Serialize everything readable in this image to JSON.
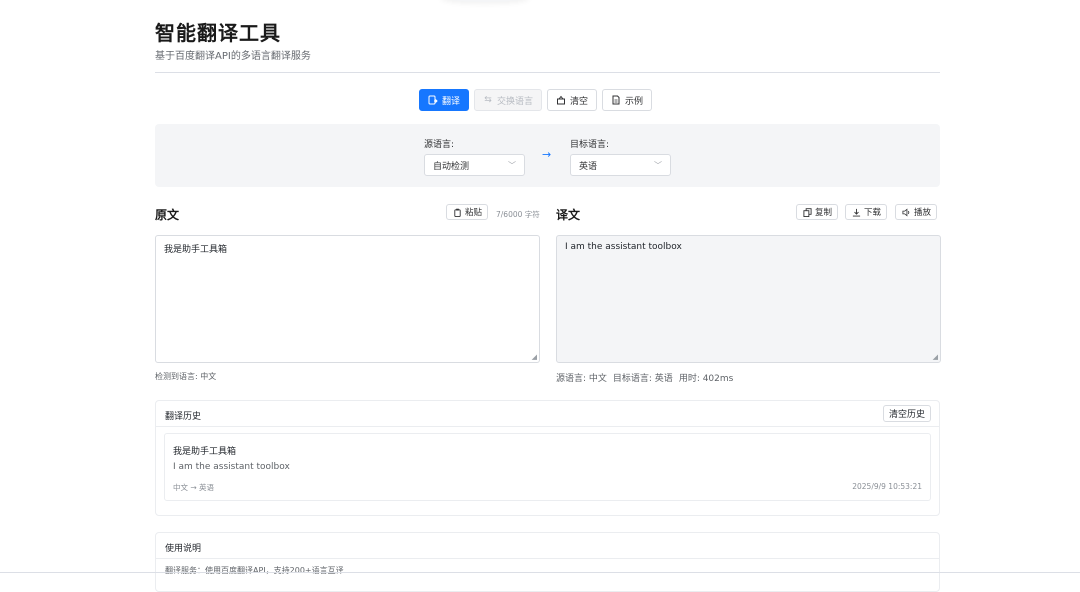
{
  "header": {
    "title": "智能翻译工具",
    "subtitle": "基于百度翻译API的多语言翻译服务"
  },
  "toolbar": {
    "translate_label": "翻译",
    "swap_label": "交换语言",
    "clear_label": "清空",
    "example_label": "示例"
  },
  "languages": {
    "source_label": "源语言:",
    "source_value": "自动检测",
    "target_label": "目标语言:",
    "target_value": "英语",
    "arrow": "→"
  },
  "source_pane": {
    "title": "原文",
    "paste_label": "粘贴",
    "char_count": "7/6000 字符",
    "text": "我是助手工具箱",
    "detected": "检测到语言: 中文"
  },
  "target_pane": {
    "title": "译文",
    "copy_label": "复制",
    "download_label": "下载",
    "play_label": "播放",
    "text": "I am the assistant toolbox",
    "meta_source": "源语言: 中文",
    "meta_target": "目标语言: 英语",
    "meta_time": "用时: 402ms"
  },
  "history": {
    "title": "翻译历史",
    "clear_label": "清空历史",
    "items": [
      {
        "source": "我是助手工具箱",
        "target": "I am the assistant toolbox",
        "langs": "中文 → 英语",
        "time": "2025/9/9 10:53:21"
      }
    ]
  },
  "usage": {
    "title": "使用说明",
    "partial_line": "翻译服务：使用百度翻译API，支持200+语言互译"
  },
  "colors": {
    "primary": "#1677ff",
    "panel_bg": "#f4f5f7"
  }
}
